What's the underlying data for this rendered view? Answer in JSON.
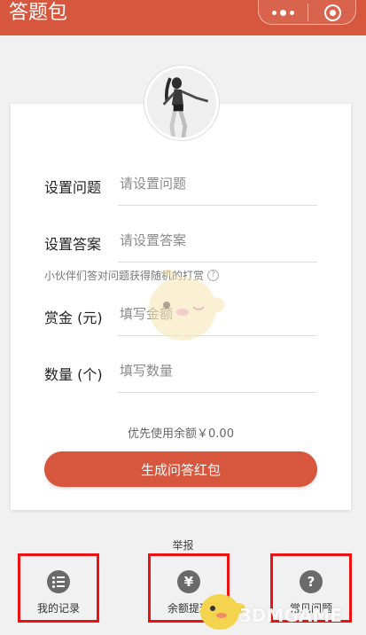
{
  "header": {
    "title": "答题包"
  },
  "form": {
    "question": {
      "label": "设置问题",
      "placeholder": "请设置问题"
    },
    "answer": {
      "label": "设置答案",
      "placeholder": "请设置答案"
    },
    "hint": "小伙伴们答对问题获得随机的打赏",
    "amount": {
      "label": "赏金 (元)",
      "placeholder": "填写金额"
    },
    "quantity": {
      "label": "数量 (个)",
      "placeholder": "填写数量"
    },
    "balance_text": "优先使用余额￥0.00",
    "submit_label": "生成问答红包"
  },
  "report_label": "举报",
  "nav": [
    {
      "label": "我的记录",
      "icon": "list-icon"
    },
    {
      "label": "余额提现",
      "icon": "yen-icon",
      "glyph": "¥"
    },
    {
      "label": "常见问题",
      "icon": "question-icon",
      "glyph": "?"
    }
  ],
  "watermark": "3DMGAME",
  "colors": {
    "accent": "#d6573e",
    "highlight": "#ee1111"
  }
}
